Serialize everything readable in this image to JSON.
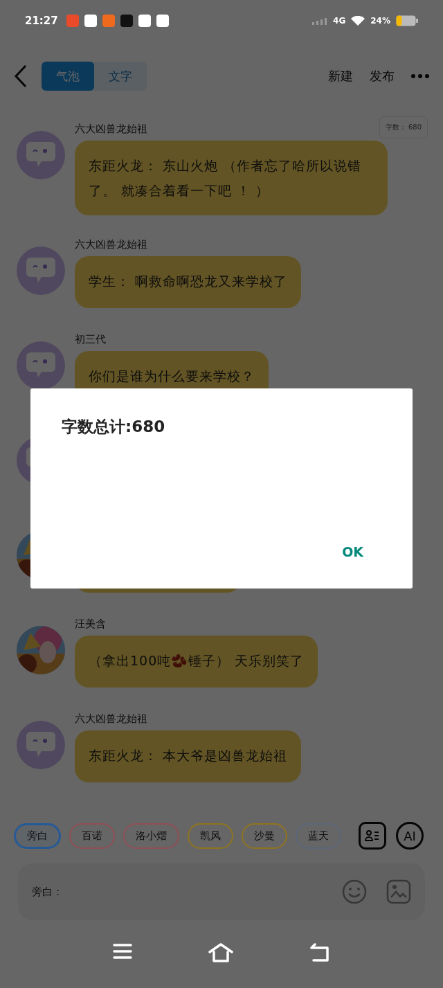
{
  "status_bar": {
    "time": "21:27",
    "network": "4G",
    "battery": "24%"
  },
  "header": {
    "tabs": [
      {
        "label": "气泡",
        "selected": true
      },
      {
        "label": "文字",
        "selected": false
      }
    ],
    "actions": [
      "新建",
      "发布"
    ]
  },
  "word_count_badge": "字数： 680",
  "messages": [
    {
      "kind": "bot",
      "name": "六大凶兽龙始祖",
      "text": "东距火龙： 东山火炮 （作者忘了哈所以说错了。 就凑合着看一下吧 ！ ）"
    },
    {
      "kind": "bot",
      "name": "六大凶兽龙始祖",
      "text": "学生： 啊救命啊恐龙又来学校了"
    },
    {
      "kind": "bot",
      "name": "初三代",
      "text": "你们是谁为什么要来学校？"
    },
    {
      "kind": "bot"
    },
    {
      "kind": "picture"
    },
    {
      "kind": "picture",
      "name": "汪美含",
      "text": "（拿出100吨🫘锤子） 天乐别笑了"
    },
    {
      "kind": "bot",
      "name": "六大凶兽龙始祖",
      "text": "东距火龙： 本大爷是凶兽龙始祖"
    }
  ],
  "characters": [
    {
      "label": "旁白",
      "selected": true,
      "color": "#255a96"
    },
    {
      "label": "百诺",
      "selected": false,
      "color": "#8f4f56"
    },
    {
      "label": "洛小熠",
      "selected": false,
      "color": "#8f4f56"
    },
    {
      "label": "凯风",
      "selected": false,
      "color": "#8f7420"
    },
    {
      "label": "沙曼",
      "selected": false,
      "color": "#8f7420"
    },
    {
      "label": "蓝天",
      "selected": false,
      "color": "#5c6679"
    }
  ],
  "ai_button": "AI",
  "input": {
    "label": "旁白："
  },
  "dialog": {
    "message": "字数总计:680",
    "button": "OK"
  }
}
